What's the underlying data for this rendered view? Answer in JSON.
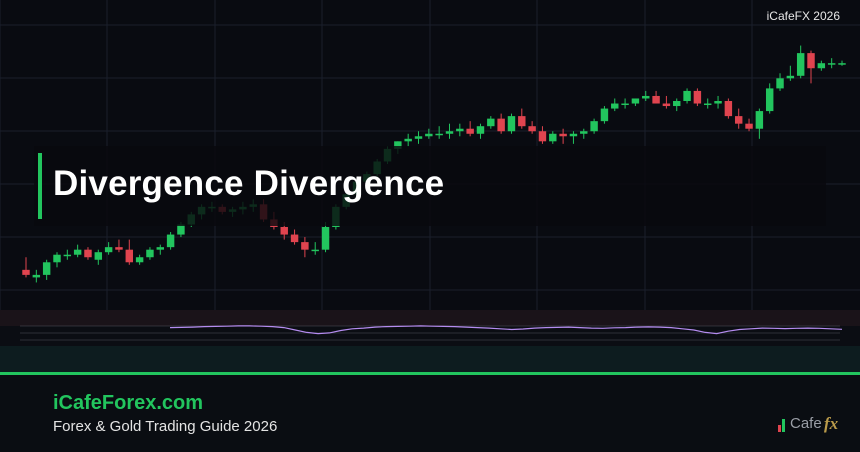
{
  "watermark": "iCafeFX 2026",
  "title": "Divergence Divergence",
  "footer": {
    "brand": "iCafeForex.com",
    "tagline": "Forex & Gold Trading Guide 2026"
  },
  "logo": {
    "text": "Cafe",
    "fx": "fx"
  },
  "colors": {
    "background": "#090b11",
    "bullish": "#22c55e",
    "bearish": "#e0444f",
    "indicator_line": "#b58cf0",
    "accent": "#22c55e"
  },
  "chart_data": {
    "type": "candlestick",
    "title": "",
    "xlabel": "",
    "ylabel": "",
    "grid": true,
    "ylim": [
      0,
      100
    ],
    "candles": [
      {
        "o": 8,
        "h": 13,
        "l": 5,
        "c": 6
      },
      {
        "o": 5,
        "h": 8,
        "l": 3,
        "c": 6
      },
      {
        "o": 6,
        "h": 12,
        "l": 4,
        "c": 11
      },
      {
        "o": 11,
        "h": 15,
        "l": 9,
        "c": 14
      },
      {
        "o": 14,
        "h": 16,
        "l": 12,
        "c": 14
      },
      {
        "o": 14,
        "h": 18,
        "l": 13,
        "c": 16
      },
      {
        "o": 16,
        "h": 17,
        "l": 12,
        "c": 13
      },
      {
        "o": 12,
        "h": 16,
        "l": 10,
        "c": 15
      },
      {
        "o": 15,
        "h": 19,
        "l": 14,
        "c": 17
      },
      {
        "o": 17,
        "h": 20,
        "l": 15,
        "c": 16
      },
      {
        "o": 16,
        "h": 20,
        "l": 10,
        "c": 11
      },
      {
        "o": 11,
        "h": 14,
        "l": 10,
        "c": 13
      },
      {
        "o": 13,
        "h": 17,
        "l": 12,
        "c": 16
      },
      {
        "o": 16,
        "h": 18,
        "l": 14,
        "c": 17
      },
      {
        "o": 17,
        "h": 23,
        "l": 16,
        "c": 22
      },
      {
        "o": 22,
        "h": 27,
        "l": 21,
        "c": 26
      },
      {
        "o": 26,
        "h": 31,
        "l": 25,
        "c": 30
      },
      {
        "o": 30,
        "h": 34,
        "l": 28,
        "c": 33
      },
      {
        "o": 33,
        "h": 35,
        "l": 31,
        "c": 33
      },
      {
        "o": 33,
        "h": 34,
        "l": 30,
        "c": 31
      },
      {
        "o": 31,
        "h": 33,
        "l": 29,
        "c": 32
      },
      {
        "o": 32,
        "h": 35,
        "l": 30,
        "c": 33
      },
      {
        "o": 33,
        "h": 36,
        "l": 31,
        "c": 34
      },
      {
        "o": 34,
        "h": 36,
        "l": 27,
        "c": 28
      },
      {
        "o": 28,
        "h": 31,
        "l": 24,
        "c": 25
      },
      {
        "o": 25,
        "h": 27,
        "l": 20,
        "c": 22
      },
      {
        "o": 22,
        "h": 24,
        "l": 18,
        "c": 19
      },
      {
        "o": 19,
        "h": 21,
        "l": 13,
        "c": 16
      },
      {
        "o": 16,
        "h": 19,
        "l": 14,
        "c": 16
      },
      {
        "o": 16,
        "h": 27,
        "l": 15,
        "c": 25
      },
      {
        "o": 25,
        "h": 34,
        "l": 24,
        "c": 33
      },
      {
        "o": 33,
        "h": 39,
        "l": 32,
        "c": 38
      },
      {
        "o": 38,
        "h": 44,
        "l": 36,
        "c": 43
      },
      {
        "o": 43,
        "h": 47,
        "l": 41,
        "c": 46
      },
      {
        "o": 46,
        "h": 52,
        "l": 45,
        "c": 51
      },
      {
        "o": 51,
        "h": 57,
        "l": 50,
        "c": 56
      },
      {
        "o": 56,
        "h": 59,
        "l": 54,
        "c": 59
      },
      {
        "o": 59,
        "h": 62,
        "l": 57,
        "c": 60
      },
      {
        "o": 60,
        "h": 63,
        "l": 58,
        "c": 61
      },
      {
        "o": 61,
        "h": 64,
        "l": 60,
        "c": 62
      },
      {
        "o": 62,
        "h": 65,
        "l": 60,
        "c": 62
      },
      {
        "o": 62,
        "h": 66,
        "l": 60,
        "c": 63
      },
      {
        "o": 63,
        "h": 66,
        "l": 61,
        "c": 64
      },
      {
        "o": 64,
        "h": 67,
        "l": 61,
        "c": 62
      },
      {
        "o": 62,
        "h": 66,
        "l": 60,
        "c": 65
      },
      {
        "o": 65,
        "h": 69,
        "l": 64,
        "c": 68
      },
      {
        "o": 68,
        "h": 70,
        "l": 62,
        "c": 63
      },
      {
        "o": 63,
        "h": 70,
        "l": 62,
        "c": 69
      },
      {
        "o": 69,
        "h": 72,
        "l": 64,
        "c": 65
      },
      {
        "o": 65,
        "h": 67,
        "l": 62,
        "c": 63
      },
      {
        "o": 63,
        "h": 65,
        "l": 58,
        "c": 59
      },
      {
        "o": 59,
        "h": 63,
        "l": 58,
        "c": 62
      },
      {
        "o": 62,
        "h": 64,
        "l": 58,
        "c": 61
      },
      {
        "o": 61,
        "h": 63,
        "l": 58,
        "c": 62
      },
      {
        "o": 62,
        "h": 64,
        "l": 60,
        "c": 63
      },
      {
        "o": 63,
        "h": 68,
        "l": 62,
        "c": 67
      },
      {
        "o": 67,
        "h": 73,
        "l": 66,
        "c": 72
      },
      {
        "o": 72,
        "h": 76,
        "l": 71,
        "c": 74
      },
      {
        "o": 74,
        "h": 76,
        "l": 72,
        "c": 74
      },
      {
        "o": 74,
        "h": 76,
        "l": 73,
        "c": 76
      },
      {
        "o": 76,
        "h": 79,
        "l": 75,
        "c": 77
      },
      {
        "o": 77,
        "h": 79,
        "l": 74,
        "c": 74
      },
      {
        "o": 74,
        "h": 77,
        "l": 72,
        "c": 73
      },
      {
        "o": 73,
        "h": 76,
        "l": 71,
        "c": 75
      },
      {
        "o": 75,
        "h": 80,
        "l": 74,
        "c": 79
      },
      {
        "o": 79,
        "h": 80,
        "l": 73,
        "c": 74
      },
      {
        "o": 74,
        "h": 76,
        "l": 72,
        "c": 74
      },
      {
        "o": 74,
        "h": 77,
        "l": 72,
        "c": 75
      },
      {
        "o": 75,
        "h": 76,
        "l": 68,
        "c": 69
      },
      {
        "o": 69,
        "h": 72,
        "l": 64,
        "c": 66
      },
      {
        "o": 66,
        "h": 68,
        "l": 63,
        "c": 64
      },
      {
        "o": 64,
        "h": 72,
        "l": 60,
        "c": 71
      },
      {
        "o": 71,
        "h": 82,
        "l": 70,
        "c": 80
      },
      {
        "o": 80,
        "h": 86,
        "l": 79,
        "c": 84
      },
      {
        "o": 84,
        "h": 89,
        "l": 83,
        "c": 85
      },
      {
        "o": 85,
        "h": 97,
        "l": 84,
        "c": 94
      },
      {
        "o": 94,
        "h": 95,
        "l": 82,
        "c": 88
      },
      {
        "o": 88,
        "h": 91,
        "l": 87,
        "c": 90
      },
      {
        "o": 90,
        "h": 92,
        "l": 88,
        "c": 90
      },
      {
        "o": 90,
        "h": 91,
        "l": 89,
        "c": 90
      }
    ],
    "indicator": {
      "ylim": [
        0,
        100
      ],
      "values": [
        60,
        61,
        62,
        64,
        65,
        66,
        67,
        67,
        66,
        64,
        60,
        50,
        40,
        35,
        38,
        48,
        55,
        58,
        62,
        64,
        65,
        66,
        67,
        66,
        65,
        64,
        62,
        60,
        58,
        55,
        52,
        54,
        58,
        60,
        61,
        62,
        60,
        58,
        57,
        59,
        60,
        62,
        63,
        62,
        60,
        55,
        50,
        40,
        35,
        45,
        52,
        55,
        58,
        57,
        56,
        57,
        58,
        57,
        55,
        53
      ]
    }
  }
}
